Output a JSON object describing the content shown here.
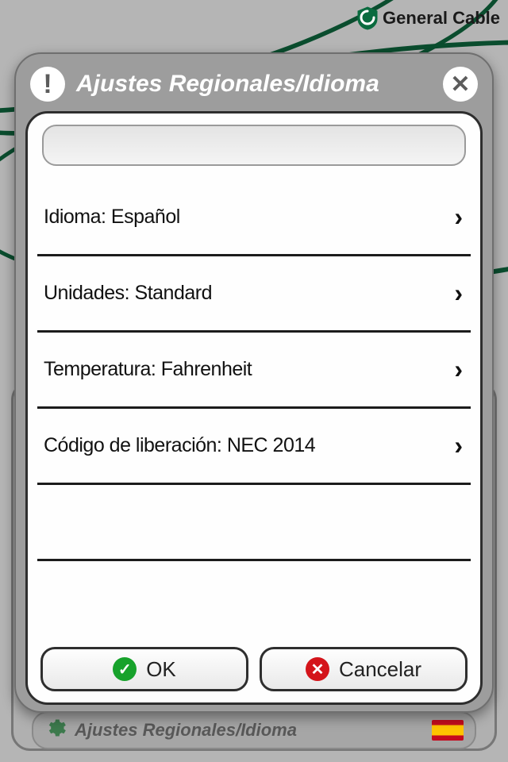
{
  "brand": {
    "name": "General Cable"
  },
  "footer": {
    "label": "Ajustes Regionales/Idioma",
    "flag": "es"
  },
  "modal": {
    "title": "Ajustes Regionales/Idioma",
    "rows": [
      {
        "label": "Idioma: Español"
      },
      {
        "label": "Unidades: Standard"
      },
      {
        "label": "Temperatura: Fahrenheit"
      },
      {
        "label": "Código de liberación: NEC 2014"
      },
      {
        "label": ""
      },
      {
        "label": ""
      }
    ],
    "buttons": {
      "ok": "OK",
      "cancel": "Cancelar"
    }
  }
}
